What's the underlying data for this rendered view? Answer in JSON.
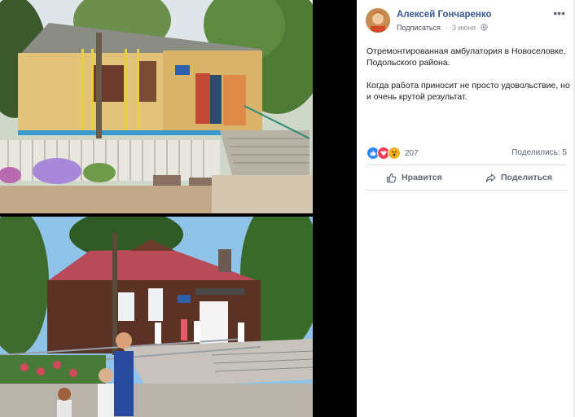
{
  "post": {
    "author": "Алексей Гончаренко",
    "follow_label": "Подписаться",
    "separator": "·",
    "date": "3 июня",
    "more_label": "•••",
    "text_paragraph_1": "Отремонтированная амбулатория в Новоселовке, Подольского района.",
    "text_paragraph_2": "Когда работа приносит не просто удовольствие, но и очень крутой результат.",
    "reactions": {
      "icons": [
        "like-icon",
        "love-icon",
        "wow-icon"
      ],
      "count": "207"
    },
    "shares": "Поделились: 5",
    "actions": {
      "like_label": "Нравится",
      "share_label": "Поделиться"
    }
  },
  "colors": {
    "author_link": "#385898",
    "meta_text": "#90949c",
    "like_blue": "#2d88ff",
    "love_red": "#f33e58",
    "wow_yellow": "#f7b125",
    "media_background": "#000000"
  }
}
